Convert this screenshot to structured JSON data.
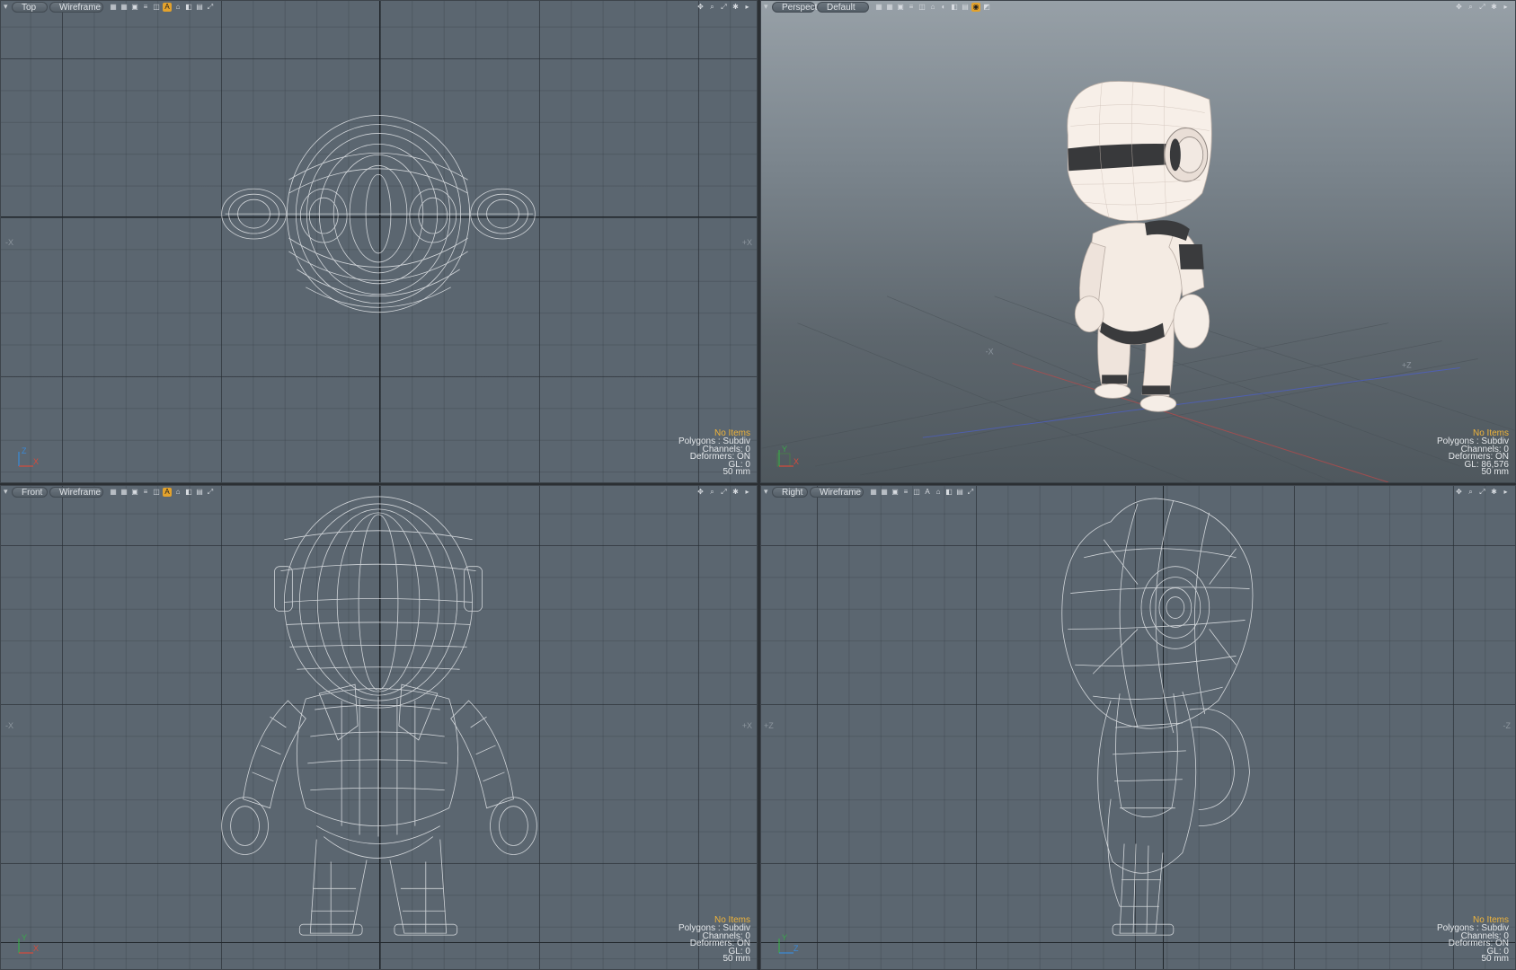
{
  "colors": {
    "viewport_bg": "#5b6670",
    "highlight": "#f0b43a",
    "active_icon": "#e3a22c",
    "wire": "#e6e9ec"
  },
  "viewports": {
    "top": {
      "view": "Top",
      "shading": "Wireframe",
      "axis_left": "-X",
      "axis_right": "+X",
      "info": {
        "items": "No Items",
        "polygons": "Polygons : Subdiv",
        "channels": "Channels: 0",
        "deformers": "Deformers: ON",
        "gl": "GL: 0",
        "scale": "50 mm"
      },
      "gizmo": {
        "axis1": "Z",
        "axis2": "X"
      }
    },
    "perspective": {
      "view": "Perspect",
      "shading": "Default",
      "axis_left": "-X",
      "axis_right": "+Z",
      "info": {
        "items": "No Items",
        "polygons": "Polygons : Subdiv",
        "channels": "Channels: 0",
        "deformers": "Deformers: ON",
        "gl": "GL: 86,576",
        "scale": "50 mm"
      },
      "gizmo": {
        "axis1": "Y",
        "axis2": "X"
      }
    },
    "front": {
      "view": "Front",
      "shading": "Wireframe",
      "axis_left": "-X",
      "axis_right": "+X",
      "info": {
        "items": "No Items",
        "polygons": "Polygons : Subdiv",
        "channels": "Channels: 0",
        "deformers": "Deformers: ON",
        "gl": "GL: 0",
        "scale": "50 mm"
      },
      "gizmo": {
        "axis1": "Y",
        "axis2": "X"
      }
    },
    "right": {
      "view": "Right",
      "shading": "Wireframe",
      "axis_left": "+Z",
      "axis_right": "-Z",
      "info": {
        "items": "No Items",
        "polygons": "Polygons : Subdiv",
        "channels": "Channels: 0",
        "deformers": "Deformers: ON",
        "gl": "GL: 0",
        "scale": "50 mm"
      },
      "gizmo": {
        "axis1": "Y",
        "axis2": "Z"
      }
    }
  },
  "toolbar_icons": [
    "grid-icon",
    "grid-icon",
    "solid-icon",
    "layers-icon",
    "texture-icon",
    "lighting-icon",
    "shading-icon",
    "wire-icon",
    "ghost-icon",
    "visibility-icon",
    "settings-icon"
  ],
  "toolbar_right_icons": [
    "move-view-icon",
    "zoom-icon",
    "maximize-icon",
    "gear-icon",
    "arrow-icon"
  ]
}
